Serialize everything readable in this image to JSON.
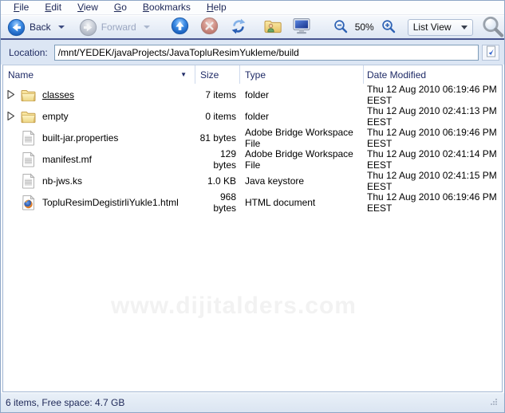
{
  "menubar": {
    "items": [
      {
        "label": "File"
      },
      {
        "label": "Edit"
      },
      {
        "label": "View"
      },
      {
        "label": "Go"
      },
      {
        "label": "Bookmarks"
      },
      {
        "label": "Help"
      }
    ]
  },
  "toolbar": {
    "back_label": "Back",
    "forward_label": "Forward",
    "zoom_level": "50%",
    "view_mode": "List View",
    "icons": {
      "back": "back-circle-arrow",
      "forward": "forward-circle-arrow",
      "up": "up-circle-arrow",
      "stop": "stop-red-x",
      "refresh": "refresh-arrows",
      "home": "home-folder-person",
      "computer": "desktop-computer",
      "zoom_out": "magnifier-minus",
      "zoom_in": "magnifier-plus",
      "search": "magnifier"
    }
  },
  "location": {
    "label": "Location:",
    "value": "/mnt/YEDEK/javaProjects/JavaTopluResimYukleme/build"
  },
  "filelist": {
    "columns": [
      "Name",
      "Size",
      "Type",
      "Date Modified"
    ],
    "sort_column": "Name",
    "sort_indicator": "▼",
    "rows": [
      {
        "name": "classes",
        "size": "7 items",
        "type": "folder",
        "date": "Thu 12 Aug 2010 06:19:46 PM EEST",
        "icon": "folder-icon",
        "expander": true
      },
      {
        "name": "empty",
        "size": "0 items",
        "type": "folder",
        "date": "Thu 12 Aug 2010 02:41:13 PM EEST",
        "icon": "folder-icon",
        "expander": true
      },
      {
        "name": "built-jar.properties",
        "size": "81 bytes",
        "type": "Adobe Bridge Workspace File",
        "date": "Thu 12 Aug 2010 06:19:46 PM EEST",
        "icon": "file-icon",
        "expander": false
      },
      {
        "name": "manifest.mf",
        "size": "129 bytes",
        "type": "Adobe Bridge Workspace File",
        "date": "Thu 12 Aug 2010 02:41:14 PM EEST",
        "icon": "file-icon",
        "expander": false
      },
      {
        "name": "nb-jws.ks",
        "size": "1.0 KB",
        "type": "Java keystore",
        "date": "Thu 12 Aug 2010 02:41:15 PM EEST",
        "icon": "file-icon",
        "expander": false
      },
      {
        "name": "TopluResimDegistirliYukle1.html",
        "size": "968 bytes",
        "type": "HTML document",
        "date": "Thu 12 Aug 2010 06:19:46 PM EEST",
        "icon": "firefox-icon",
        "expander": false
      }
    ]
  },
  "watermark": "www.dijitalders.com",
  "statusbar": {
    "text": "6 items, Free space: 4.7 GB"
  },
  "colors": {
    "accent_blue": "#2f7ee0",
    "toolbar_separator": "#47548e",
    "location_bg": "#dce6f4",
    "header_text": "#1e2a66",
    "folder_yellow": "#efcf7a",
    "watermark_gray": "#f2f2f2"
  }
}
